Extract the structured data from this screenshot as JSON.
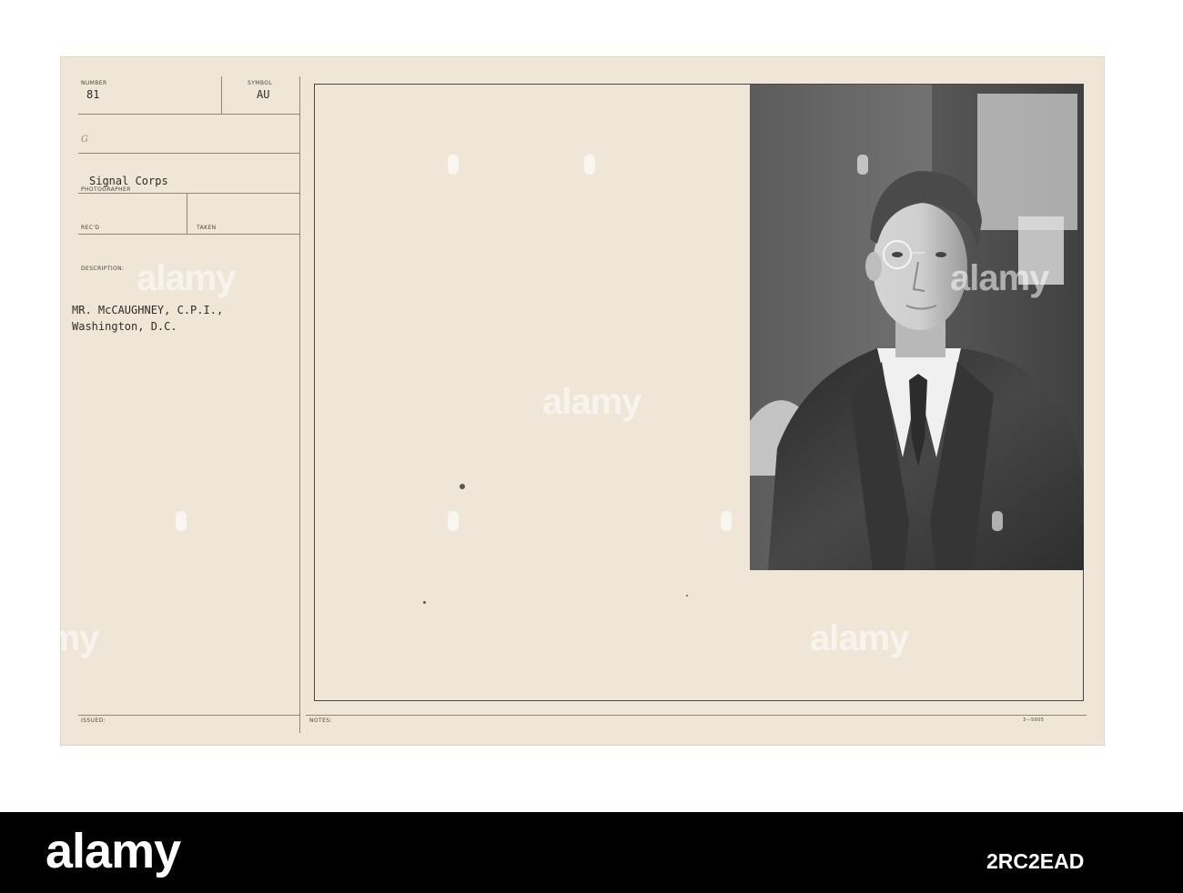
{
  "record": {
    "number_label": "NUMBER",
    "number_value": "81",
    "symbol_label": "SYMBOL",
    "symbol_value": "AU",
    "handwritten_mark": "G",
    "photographer_value": "Signal Corps",
    "photographer_label": "PHOTOGRAPHER",
    "recd_label": "REC'D",
    "taken_label": "TAKEN",
    "description_label": "DESCRIPTION:",
    "description_line1": "MR. McCAUGHNEY, C.P.I.,",
    "description_line2": "Washington, D.C.",
    "issued_label": "ISSUED:",
    "notes_label": "NOTES:",
    "form_code": "3—5005"
  },
  "watermark": {
    "text": "alamy"
  },
  "footer": {
    "logo_text": "alamy",
    "image_id": "2RC2EAD"
  }
}
